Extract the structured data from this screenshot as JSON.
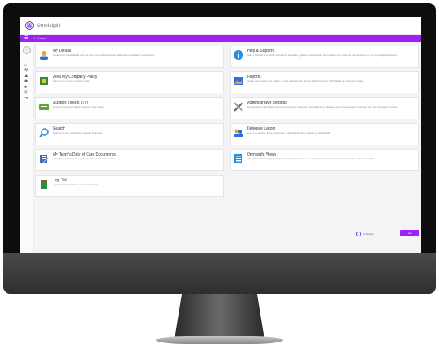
{
  "app": {
    "logo_text": "Omnisight",
    "logo_glyph": "Ⓐ"
  },
  "nav": {
    "menu_icon": "☰",
    "home_icon": "⌂",
    "home_label": "Home"
  },
  "tiles": [
    {
      "title": "My Details",
      "desc": "Update your basic details such as name and address. Assign delegation to manage your account.",
      "icon": "person-icon",
      "color": "#f0a030"
    },
    {
      "title": "Help & Support",
      "desc": "Help & Support is an online service for education, guidance and support that enables you to find the best answers for your Omnisight questions.",
      "icon": "info-icon",
      "color": "#1e90e8"
    },
    {
      "title": "View My Company Policy",
      "desc": "View a copy of your company policy.",
      "icon": "policy-icon",
      "color": "#2d8a3e"
    },
    {
      "title": "Reports",
      "desc": "Create new reports, edit, delete or view existing ones. Export directly to Excel, CSV flat file or create print tables.",
      "icon": "reports-icon",
      "color": "#2f6fd6"
    },
    {
      "title": "Support Tickets (27)",
      "desc": "Respond to support tickets raised by other users.",
      "icon": "tickets-icon",
      "color": "#5aa832"
    },
    {
      "title": "Administrative Settings",
      "desc": "Manage basic information such as Cost Codes, Currencies and Addresses. Manage new employees and customise the way Omnisight functions.",
      "icon": "tools-icon",
      "color": "#666666"
    },
    {
      "title": "Search",
      "desc": "Search for other employees who use Omnisight.",
      "icon": "search-icon",
      "color": "#1e90e8"
    },
    {
      "title": "Delegate Logon",
      "desc": "Log on to another user's account as a delegate. Perform actions on their behalf.",
      "icon": "delegate-icon",
      "color": "#f0a030"
    },
    {
      "title": "My Team's Duty of Care Documents",
      "desc": "Manage your team's driving licence and vehicle documents.",
      "icon": "documents-icon",
      "color": "#2f6fd6"
    },
    {
      "title": "Omnisight Views",
      "desc": "A selection of Omnisight forms for improving the process of everyday tasks, allowing workflow and approvals automatically.",
      "icon": "views-icon",
      "color": "#1e90e8"
    },
    {
      "title": "Log Out",
      "desc": "Log out of Omnisight and close this window.",
      "icon": "logout-icon",
      "color": "#2d8a3e"
    }
  ],
  "footer": {
    "logo_text": "Omnisight",
    "help_label": "Help"
  }
}
